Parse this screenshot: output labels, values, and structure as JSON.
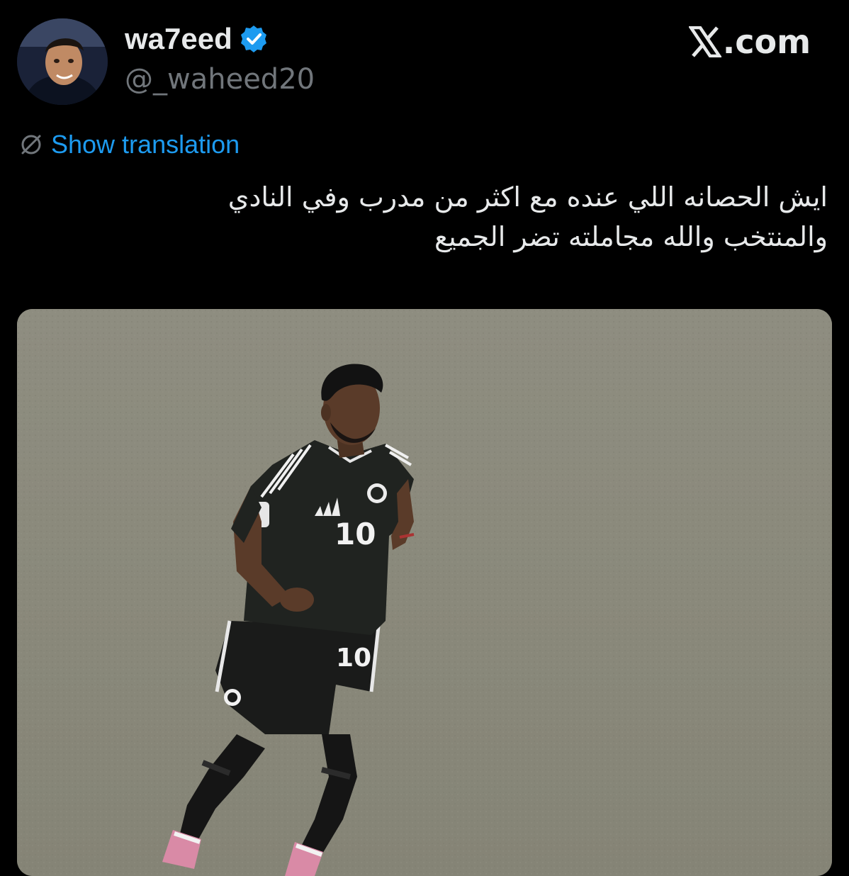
{
  "author": {
    "display_name": "wa7eed",
    "handle": "@_waheed20",
    "verified": true
  },
  "brand": {
    "label": ".com"
  },
  "translation": {
    "label": "Show translation"
  },
  "tweet": {
    "line1": "ايش الحصانه اللي عنده مع اكثر من مدرب وفي النادي",
    "line2": "والمنتخب والله مجاملته تضر الجميع"
  },
  "media": {
    "jersey_number": "10",
    "shorts_number": "10"
  },
  "colors": {
    "background": "#000000",
    "text_primary": "#e7e9ea",
    "text_secondary": "#71767b",
    "link": "#1d9bf0",
    "verified": "#1d9bf0"
  }
}
